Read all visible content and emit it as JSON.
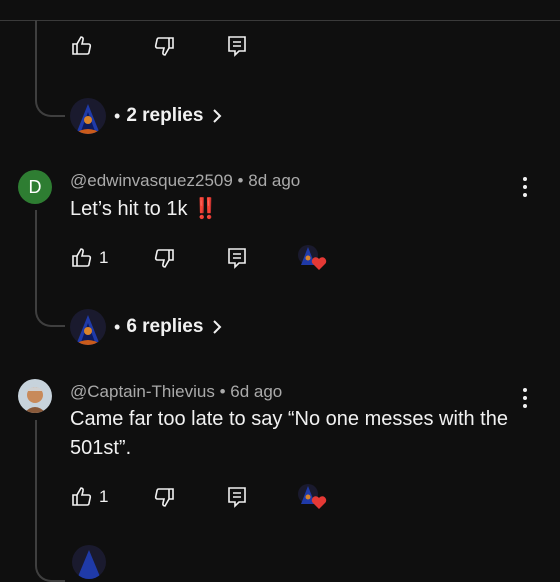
{
  "comments": [
    {
      "avatar_letter": "D",
      "author": "@edwinvasquez2509",
      "time": "8d ago",
      "text": "Let’s hit to 1k ‼️",
      "likes": "1",
      "replies_label": "6 replies"
    },
    {
      "avatar_letter": "",
      "author": "@Captain-Thievius",
      "time": "6d ago",
      "text": "Came far too late to say “No one messes with the 501st”.",
      "likes": "1",
      "replies_label": ""
    }
  ],
  "previous_thread": {
    "replies_label": "2 replies"
  },
  "separator": "•",
  "colors": {
    "background": "#0f0f0f",
    "text": "#f1f1f1",
    "meta": "#aaaaaa",
    "heart": "#e53935",
    "letter_avatar": "#2e7d32"
  },
  "icons": [
    "like-icon",
    "dislike-icon",
    "reply-icon",
    "more-vert-icon",
    "creator-heart-icon",
    "chevron-right-icon"
  ]
}
